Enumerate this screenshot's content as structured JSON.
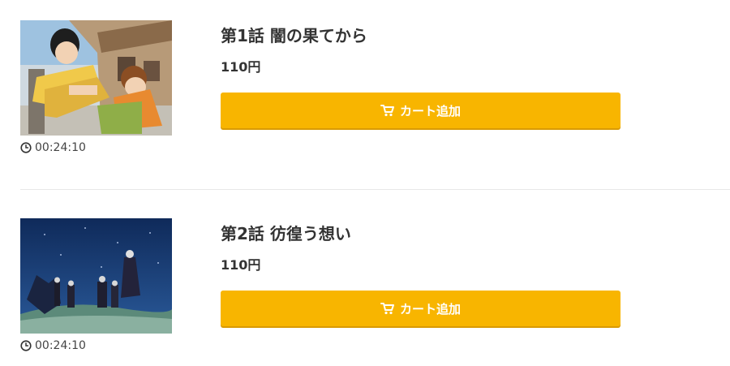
{
  "episodes": [
    {
      "title": "第1話 闇の果てから",
      "price": "110円",
      "duration": "00:24:10",
      "cart_label": "カート追加"
    },
    {
      "title": "第2話 彷徨う想い",
      "price": "110円",
      "duration": "00:24:10",
      "cart_label": "カート追加"
    }
  ],
  "icons": {
    "clock": "clock-icon",
    "cart": "cart-icon"
  },
  "colors": {
    "cart_button": "#f8b500",
    "cart_button_shadow": "#d99a00",
    "text": "#333333",
    "divider": "#e8e8e8"
  }
}
